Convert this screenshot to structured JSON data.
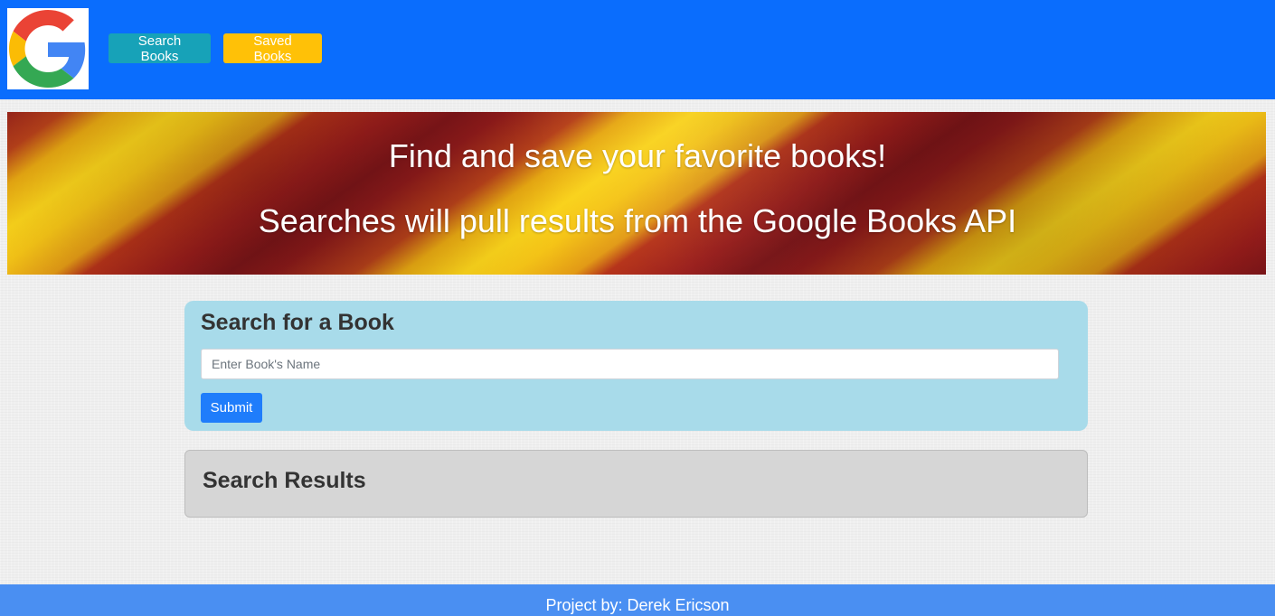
{
  "navbar": {
    "logo_icon": "google-g-logo",
    "search_books_label": "Search Books",
    "saved_books_label": "Saved Books"
  },
  "banner": {
    "line1": "Find and save your favorite books!",
    "line2": "Searches will pull results from the Google Books API"
  },
  "search": {
    "title": "Search for a Book",
    "placeholder": "Enter Book's Name",
    "value": "",
    "submit_label": "Submit"
  },
  "results": {
    "title": "Search Results"
  },
  "footer": {
    "text": "Project by: Derek Ericson"
  },
  "colors": {
    "navbar": "#0a6dfd",
    "search_button": "#17a2b8",
    "saved_button": "#ffc107",
    "search_card": "#a8dbea",
    "submit_button": "#1f7dfb",
    "results_card": "#d6d6d6",
    "footer": "#4a8ff2"
  }
}
